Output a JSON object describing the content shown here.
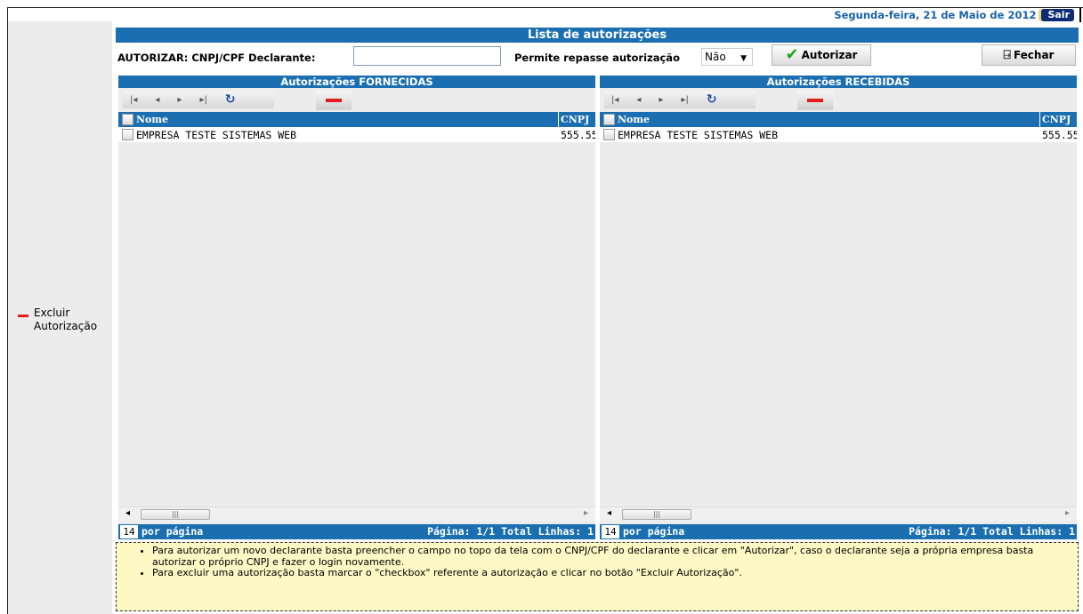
{
  "header": {
    "date": "Segunda-feira, 21 de Maio de 2012",
    "logout_label": "Sair"
  },
  "title": "Lista de autorizações",
  "toolbar": {
    "cnpj_label": "AUTORIZAR: CNPJ/CPF Declarante:",
    "cnpj_value": "",
    "repasse_label": "Permite repasse autorização",
    "repasse_value": "Não",
    "authorize_label": "Autorizar",
    "close_label": "Fechar"
  },
  "side_action": {
    "line1": "Excluir",
    "line2": "Autorização"
  },
  "panels": {
    "left": {
      "title": "Autorizações FORNECIDAS",
      "columns": [
        "Nome",
        "CNPJ"
      ],
      "rows": [
        {
          "nome": "EMPRESA TESTE SISTEMAS WEB",
          "cnpj": "555.55"
        }
      ],
      "per_page_value": "14",
      "per_page_label": "por página",
      "pagination": "Página: 1/1 Total Linhas: 1"
    },
    "right": {
      "title": "Autorizações RECEBIDAS",
      "columns": [
        "Nome",
        "CNPJ"
      ],
      "rows": [
        {
          "nome": "EMPRESA TESTE SISTEMAS WEB",
          "cnpj": "555.55"
        }
      ],
      "per_page_value": "14",
      "per_page_label": "por página",
      "pagination": "Página: 1/1 Total Linhas: 1"
    }
  },
  "help": {
    "items": [
      "Para autorizar um novo declarante basta preencher o campo no topo da tela com o CNPJ/CPF do declarante e clicar em \"Autorizar\", caso o declarante seja a própria empresa basta autorizar o próprio CNPJ e fazer o login novamente.",
      "Para excluir uma autorização basta marcar o \"checkbox\" referente a autorização e clicar no botão \"Excluir Autorização\"."
    ]
  },
  "colors": {
    "header_blue": "#1b6fb0",
    "date_blue": "#1a63a8",
    "delete_red": "#e31b1b",
    "help_bg": "#fdf8c4"
  }
}
